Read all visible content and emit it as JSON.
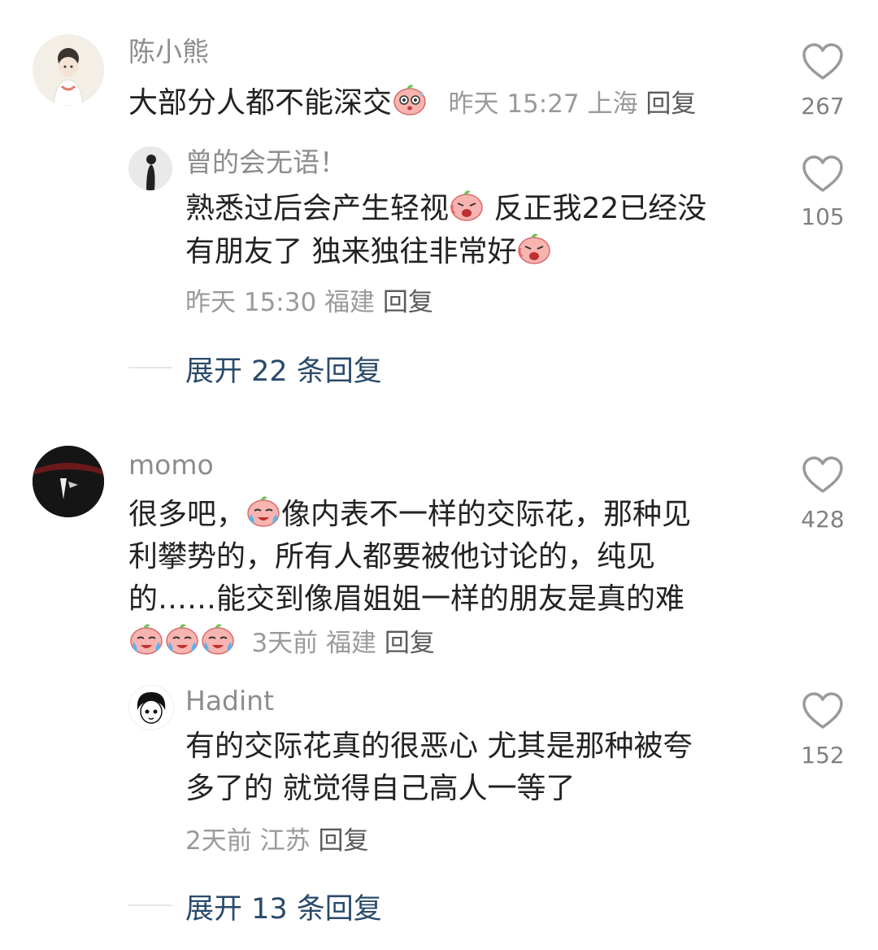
{
  "comments": [
    {
      "name": "陈小熊",
      "text": "大部分人都不能深交",
      "time": "昨天 15:27",
      "location": "上海",
      "reply_label": "回复",
      "likes": "267",
      "replies": [
        {
          "name": "曾的会无语！",
          "line1": "熟悉过后会产生轻视",
          "line1b": " 反正我22已经没",
          "line2": "有朋友了 独来独往非常好",
          "time": "昨天 15:30",
          "location": "福建",
          "reply_label": "回复",
          "likes": "105"
        }
      ],
      "expand_label": "展开 22 条回复"
    },
    {
      "name": "momo",
      "line1": "很多吧，",
      "line1b": "像内表不一样的交际花，那种见",
      "line2": "利攀势的，所有人都要被他讨论的，纯见",
      "line3": "的……能交到像眉姐姐一样的朋友是真的难",
      "time": "3天前",
      "location": "福建",
      "reply_label": "回复",
      "likes": "428",
      "replies": [
        {
          "name": "Hadint",
          "line1": "有的交际花真的很恶心 尤其是那种被夸",
          "line2": "多了的 就觉得自己高人一等了",
          "time": "2天前",
          "location": "江苏",
          "reply_label": "回复",
          "likes": "152"
        }
      ],
      "expand_label": "展开 13 条回复"
    }
  ],
  "icons": {
    "like": "heart-outline-icon",
    "emoji_sweat": "sweat-emoji-icon",
    "emoji_angry": "angry-emoji-icon",
    "emoji_cry": "cry-emoji-icon"
  },
  "colors": {
    "name": "#8d8d8d",
    "text": "#222222",
    "meta": "#9a9a9a",
    "expand": "#2a4a6a",
    "emoji_pink": "#f5a3a3"
  }
}
